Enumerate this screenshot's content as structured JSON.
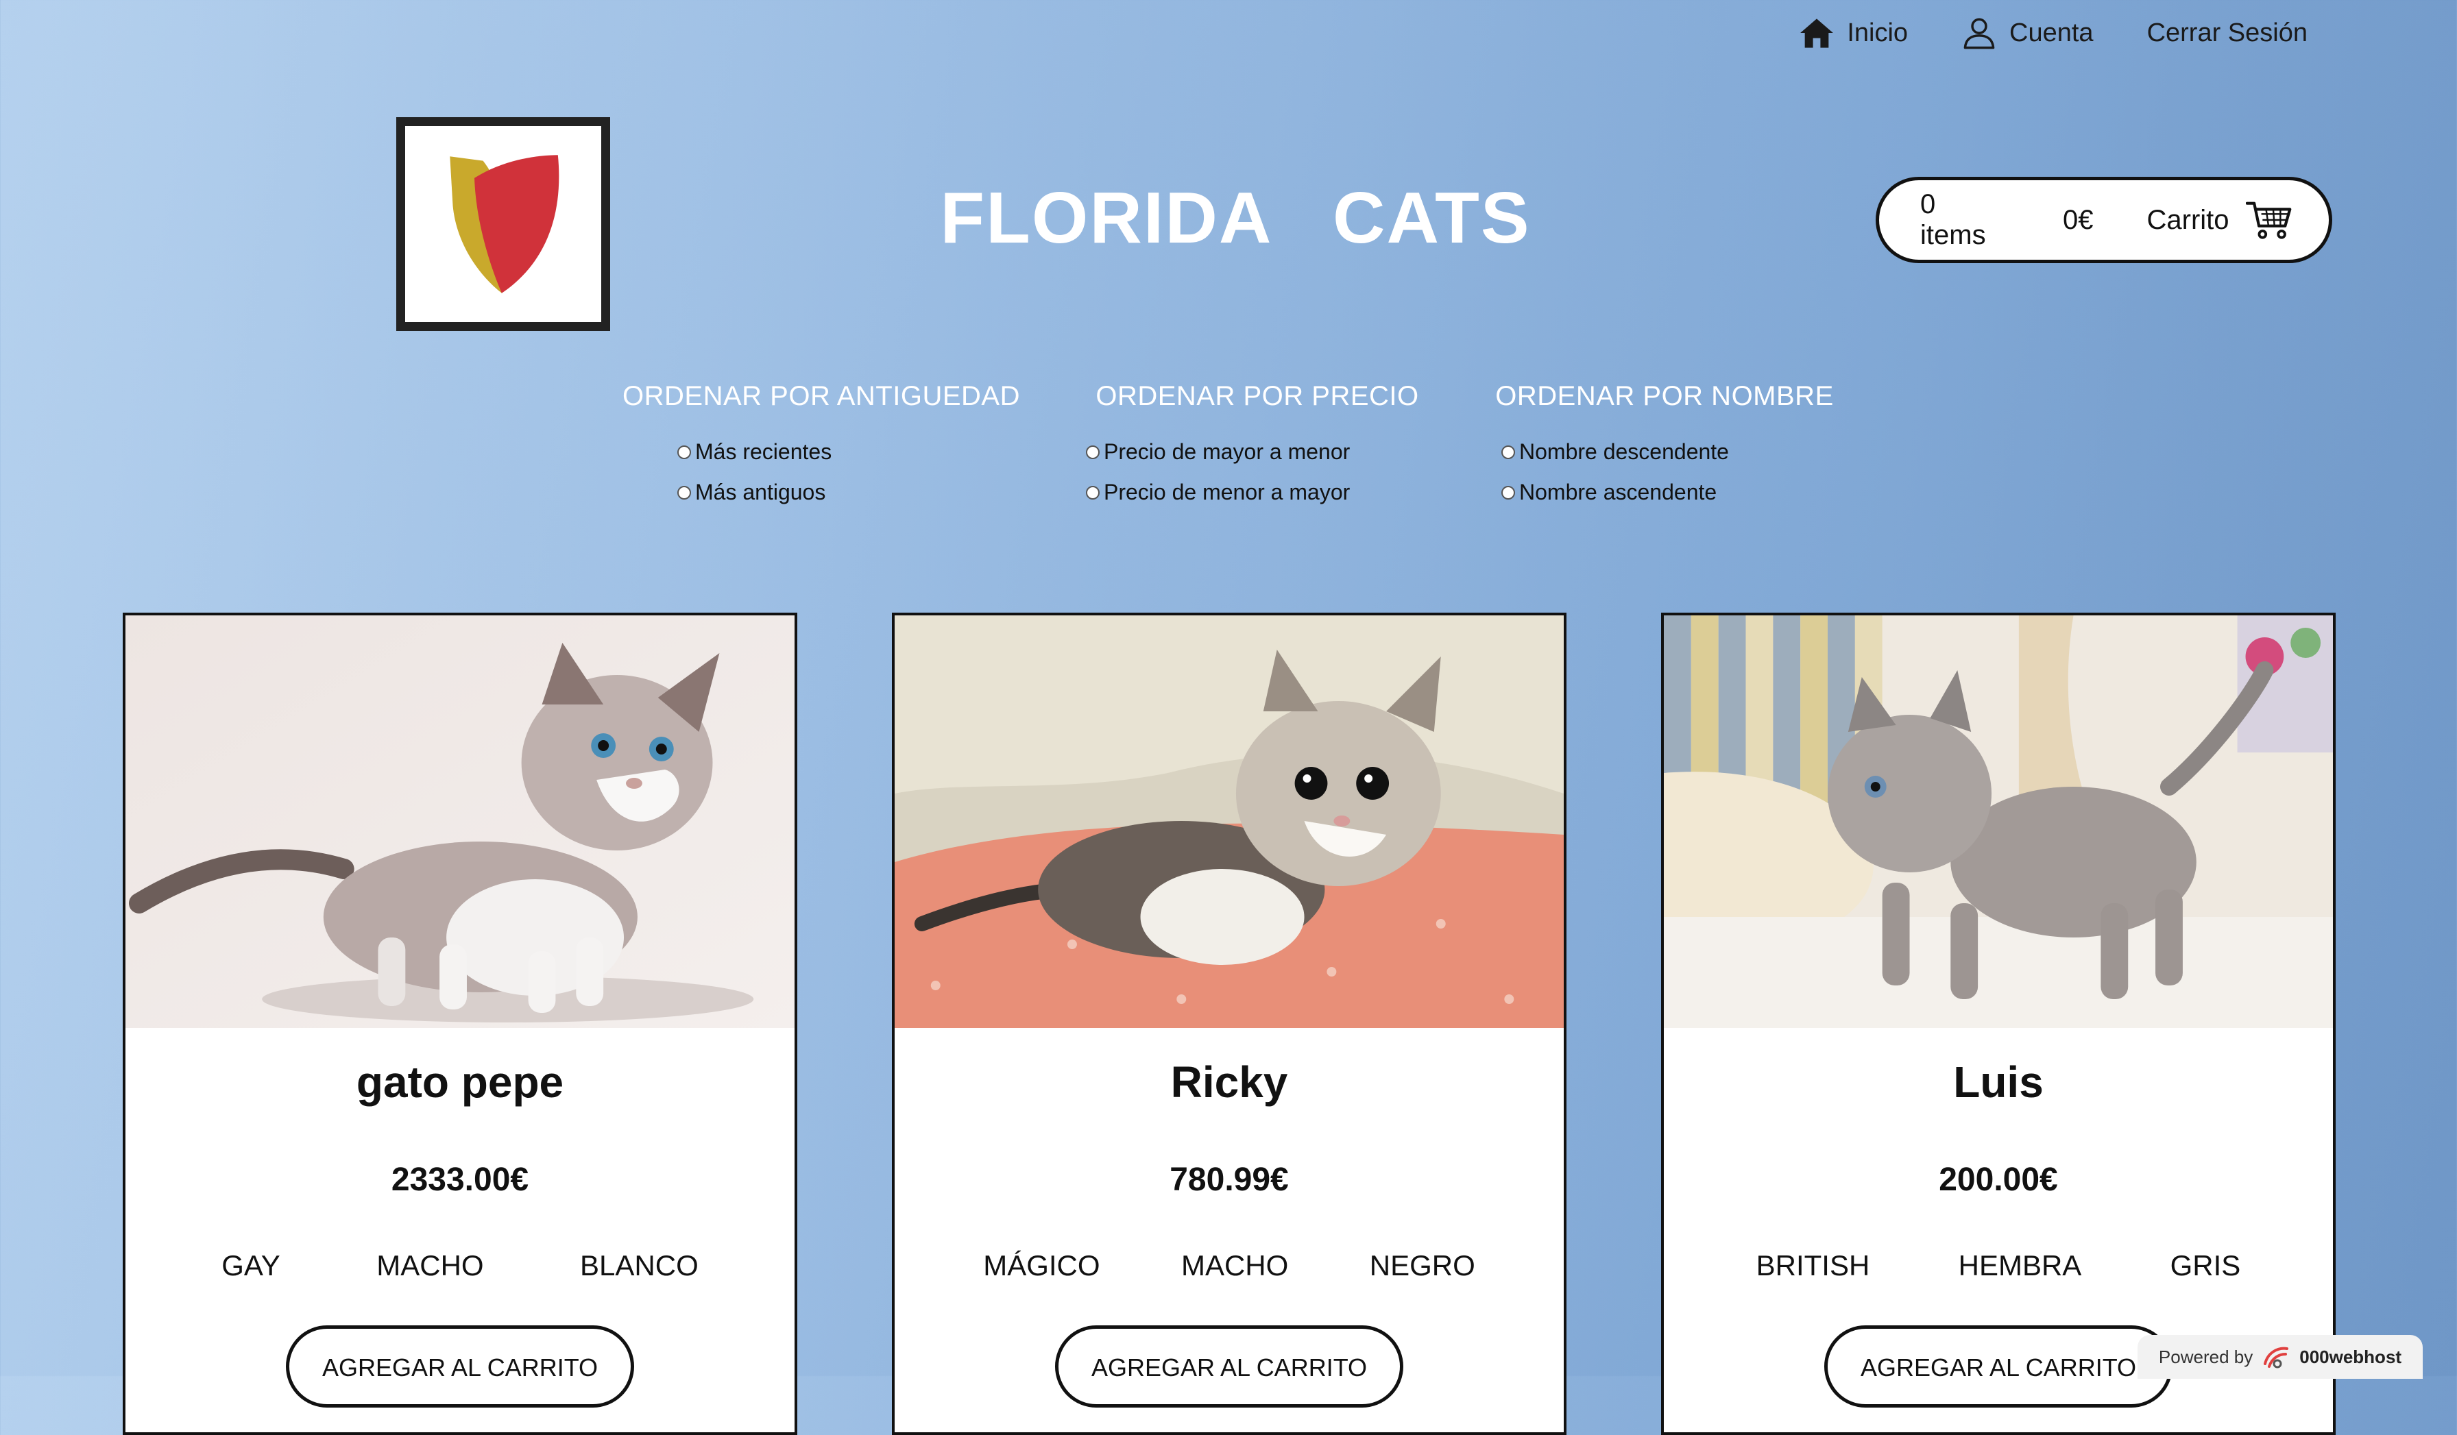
{
  "nav": {
    "items": [
      {
        "label": "Inicio",
        "icon": "home-icon"
      },
      {
        "label": "Cuenta",
        "icon": "user-icon"
      },
      {
        "label": "Cerrar Sesión"
      }
    ]
  },
  "header": {
    "title": "FLORIDA CATS",
    "logo": "shield-logo"
  },
  "cart": {
    "items": "0 items",
    "total": "0€",
    "label": "Carrito",
    "icon": "cart-icon"
  },
  "sort": [
    {
      "title": "ORDENAR POR ANTIGUEDAD",
      "options": [
        "Más recientes",
        "Más antiguos"
      ]
    },
    {
      "title": "ORDENAR POR PRECIO",
      "options": [
        "Precio de mayor a menor",
        "Precio de menor a mayor"
      ]
    },
    {
      "title": "ORDENAR POR NOMBRE",
      "options": [
        "Nombre descendente",
        "Nombre ascendente"
      ]
    }
  ],
  "cards": [
    {
      "name": "gato pepe",
      "price": "2333.00€",
      "tags": [
        "GAY",
        "MACHO",
        "BLANCO"
      ],
      "button": "AGREGAR AL CARRITO"
    },
    {
      "name": "Ricky",
      "price": "780.99€",
      "tags": [
        "MÁGICO",
        "MACHO",
        "NEGRO"
      ],
      "button": "AGREGAR AL CARRITO"
    },
    {
      "name": "Luis",
      "price": "200.00€",
      "tags": [
        "BRITISH",
        "HEMBRA",
        "GRIS"
      ],
      "button": "AGREGAR AL CARRITO"
    }
  ],
  "footer": {
    "powered_by": "Powered by",
    "host": "000webhost"
  },
  "colors": {
    "title": "#ffffff",
    "logo_red": "#d0323a",
    "logo_gold": "#c9a92c"
  }
}
